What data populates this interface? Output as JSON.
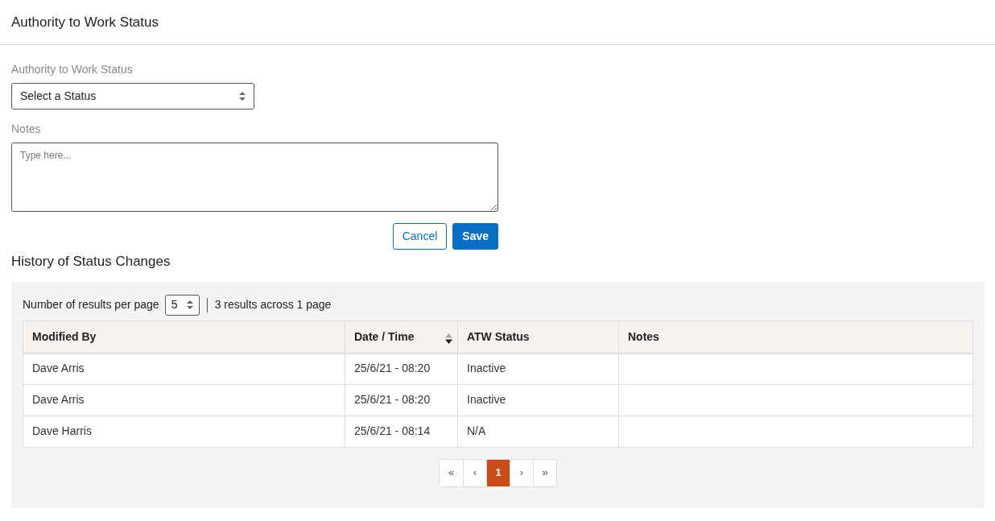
{
  "header": {
    "title": "Authority to Work Status"
  },
  "form": {
    "status_label": "Authority to Work Status",
    "status_select": {
      "value": "Select a Status"
    },
    "notes_label": "Notes",
    "notes_field": {
      "placeholder": "Type here..."
    },
    "buttons": [
      {
        "label": "Cancel",
        "kind": "secondary"
      },
      {
        "label": "Save",
        "kind": "primary"
      }
    ]
  },
  "history": {
    "title": "History of Status Changes",
    "per_page_label": "Number of results per page",
    "per_page": "5",
    "summary": "3 results across 1 page",
    "table": {
      "columns": [
        {
          "label": "Modified By",
          "sorted": false
        },
        {
          "label": "Date / Time",
          "sorted": true
        },
        {
          "label": "ATW Status",
          "sorted": false
        },
        {
          "label": "Notes",
          "sorted": false
        }
      ],
      "rows": [
        [
          "Dave Arris",
          "25/6/21 - 08:20",
          "Inactive",
          ""
        ],
        [
          "Dave Arris",
          "25/6/21 - 08:20",
          "Inactive",
          ""
        ],
        [
          "Dave Harris",
          "25/6/21 - 08:14",
          "N/A",
          ""
        ]
      ]
    },
    "pagination": [
      {
        "label": "«",
        "selected": false
      },
      {
        "label": "‹",
        "selected": false
      },
      {
        "label": "1",
        "selected": true
      },
      {
        "label": "›",
        "selected": false
      },
      {
        "label": "»",
        "selected": false
      }
    ]
  }
}
